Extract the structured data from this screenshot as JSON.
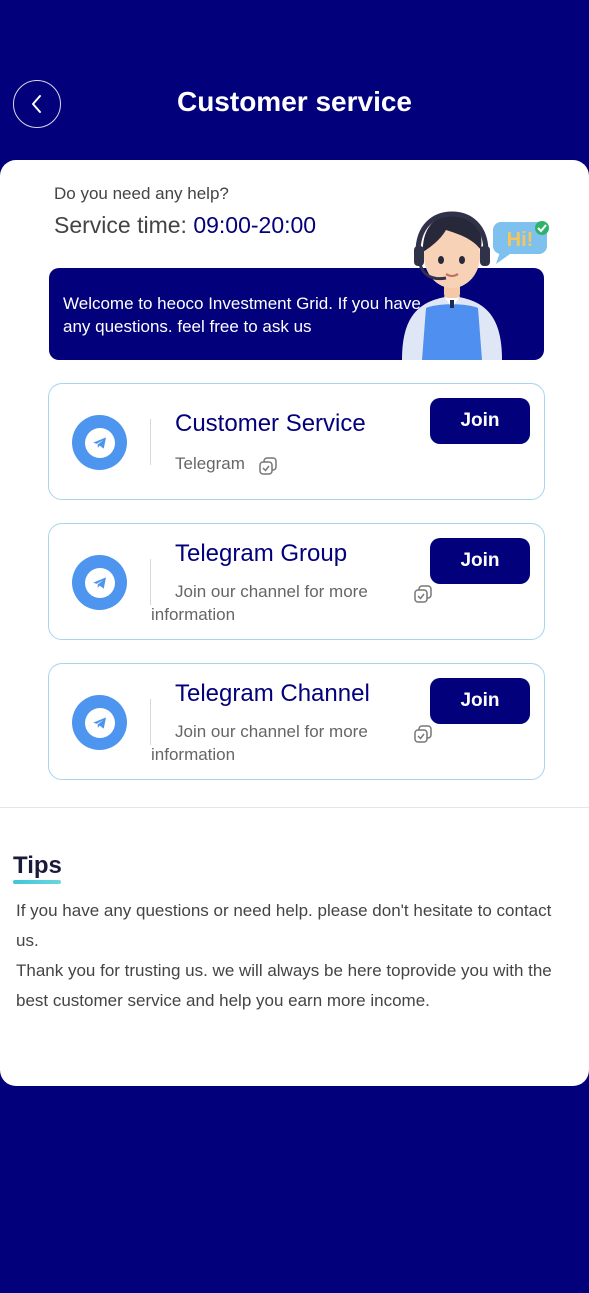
{
  "header": {
    "title": "Customer service"
  },
  "help": {
    "question": "Do you need any help?",
    "service_time_label": "Service time: ",
    "service_time_value": "09:00-20:00"
  },
  "welcome": {
    "text": "Welcome to heoco Investment Grid. If you have any questions. feel free to ask us",
    "bubble": "Hi!"
  },
  "cards": [
    {
      "title": "Customer Service",
      "subtitle": "Telegram",
      "button": "Join"
    },
    {
      "title": "Telegram Group",
      "subtitle": "Join our channel for more information",
      "button": "Join"
    },
    {
      "title": "Telegram Channel",
      "subtitle": "Join our channel for more information",
      "button": "Join"
    }
  ],
  "tips": {
    "title": "Tips",
    "line1": "If you have any questions or need help. please don't hesitate to contact us.",
    "line2": "Thank you for trusting us. we will always be here toprovide you with the best customer service and help you earn more income."
  },
  "colors": {
    "primary": "#02007a",
    "telegram": "#4d95ee",
    "card_border": "#a8d4ee"
  },
  "icons": [
    "back-chevron-icon",
    "telegram-icon",
    "copy-icon"
  ]
}
